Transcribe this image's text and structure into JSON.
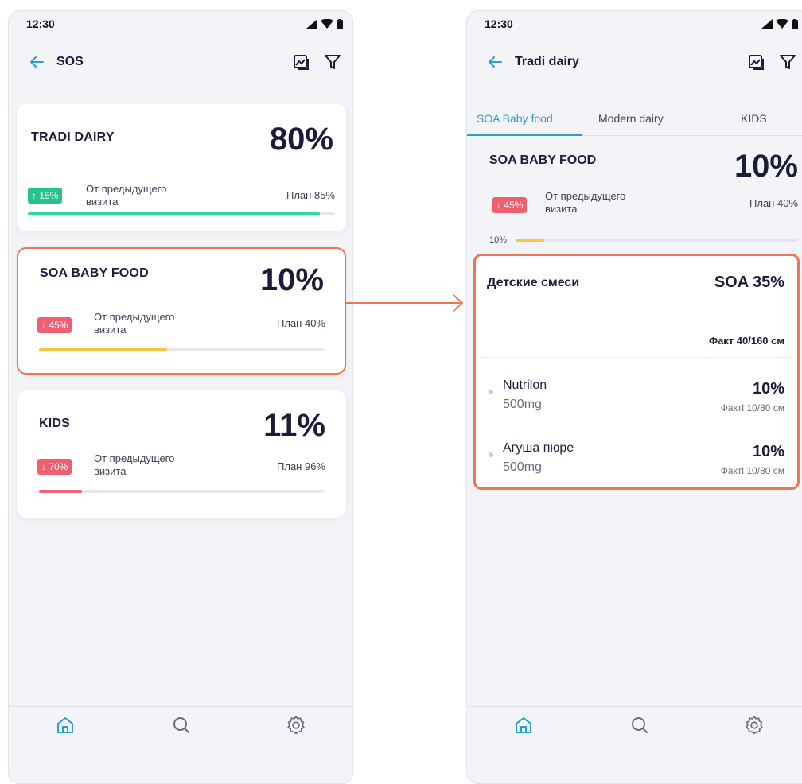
{
  "status_bar": {
    "time": "12:30"
  },
  "left": {
    "header": {
      "title": "SOS"
    },
    "cards": [
      {
        "title": "TRADI DAIRY",
        "percent": "80%",
        "trend": "↑ 15%",
        "trend_dir": "up",
        "trend_label": "От предыдущего визита",
        "plan": "План 85%",
        "progress": 0.95,
        "progress_color": "#2fd89a"
      },
      {
        "title": "SOA BABY FOOD",
        "percent": "10%",
        "trend": "↓ 45%",
        "trend_dir": "down",
        "trend_label": "От предыдущего визита",
        "plan": "План 40%",
        "progress": 0.45,
        "progress_color": "#f9c53f"
      },
      {
        "title": "KIDS",
        "percent": "11%",
        "trend": "↓ 70%",
        "trend_dir": "down",
        "trend_label": "От предыдущего визита",
        "plan": "План 96%",
        "progress": 0.15,
        "progress_color": "#ef6473"
      }
    ]
  },
  "right": {
    "header": {
      "title": "Tradi dairy"
    },
    "tabs": [
      {
        "label": "SOA Baby food",
        "active": true
      },
      {
        "label": "Modern dairy",
        "active": false
      },
      {
        "label": "KIDS",
        "active": false
      }
    ],
    "summary": {
      "title": "SOA BABY FOOD",
      "percent": "10%",
      "trend": "↓ 45%",
      "trend_label": "От предыдущего визита",
      "plan": "План 40%",
      "progress_label": "10%",
      "progress": 0.1,
      "progress_color": "#f9c53f"
    },
    "detail": {
      "title": "Детские смеси",
      "soa": "SOA 35%",
      "fact": "Факт 40/160 см",
      "products": [
        {
          "name": "Nutrilon",
          "dose": "500mg",
          "percent": "10%",
          "fact": "Фактl 10/80 см"
        },
        {
          "name": "Агуша пюре",
          "dose": "500mg",
          "percent": "10%",
          "fact": "Фактl 10/80 см"
        }
      ]
    }
  },
  "colors": {
    "accent": "#2a9fce",
    "highlight": "#f07650",
    "up": "#25c28e",
    "down": "#ef5f6f"
  },
  "icons": {
    "back": "arrow-left-icon",
    "gallery": "gallery-icon",
    "filter": "filter-icon",
    "home": "home-icon",
    "search": "search-icon",
    "settings": "gear-icon"
  }
}
